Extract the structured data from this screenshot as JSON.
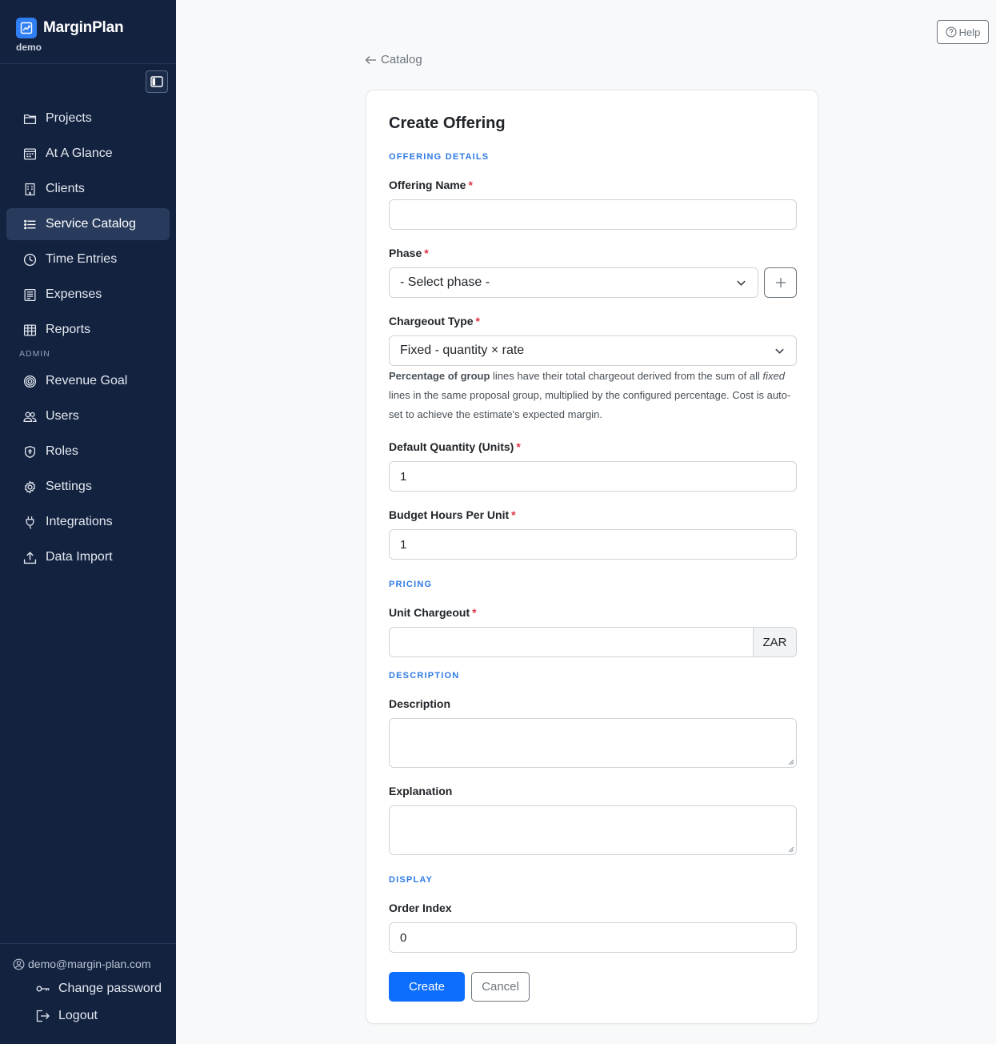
{
  "app": {
    "name": "MarginPlan",
    "tenant": "demo"
  },
  "sidebar": {
    "items": [
      {
        "label": "Projects"
      },
      {
        "label": "At A Glance"
      },
      {
        "label": "Clients"
      },
      {
        "label": "Service Catalog",
        "active": true
      },
      {
        "label": "Time Entries"
      },
      {
        "label": "Expenses"
      },
      {
        "label": "Reports"
      }
    ],
    "admin_section": "ADMIN",
    "admin_items": [
      {
        "label": "Revenue Goal"
      },
      {
        "label": "Users"
      },
      {
        "label": "Roles"
      },
      {
        "label": "Settings"
      },
      {
        "label": "Integrations"
      },
      {
        "label": "Data Import"
      }
    ]
  },
  "user": {
    "email": "demo@margin-plan.com",
    "change_password": "Change password",
    "logout": "Logout"
  },
  "header": {
    "help": "Help",
    "back": "Catalog"
  },
  "form": {
    "title": "Create Offering",
    "sections": {
      "details": "OFFERING DETAILS",
      "pricing": "PRICING",
      "description": "DESCRIPTION",
      "display": "DISPLAY"
    },
    "offering_name": {
      "label": "Offering Name",
      "value": ""
    },
    "phase": {
      "label": "Phase",
      "selected": "- Select phase -"
    },
    "chargeout_type": {
      "label": "Chargeout Type",
      "selected": "Fixed - quantity × rate",
      "help_bold": "Percentage of group",
      "help_1": " lines have their total chargeout derived from the sum of all ",
      "help_italic": "fixed",
      "help_2": " lines in the same proposal group, multiplied by the configured percentage. Cost is auto-set to achieve the estimate's expected margin."
    },
    "default_quantity": {
      "label": "Default Quantity (Units)",
      "value": "1"
    },
    "budget_hours": {
      "label": "Budget Hours Per Unit",
      "value": "1"
    },
    "unit_chargeout": {
      "label": "Unit Chargeout",
      "value": "",
      "currency": "ZAR"
    },
    "description": {
      "label": "Description",
      "value": ""
    },
    "explanation": {
      "label": "Explanation",
      "value": ""
    },
    "order_index": {
      "label": "Order Index",
      "value": "0"
    },
    "required_marker": "*",
    "create": "Create",
    "cancel": "Cancel"
  },
  "colors": {
    "sidebar_bg": "#13223f",
    "primary": "#0d6efd",
    "section_label": "#2f7ae5",
    "required": "#dc3545"
  }
}
